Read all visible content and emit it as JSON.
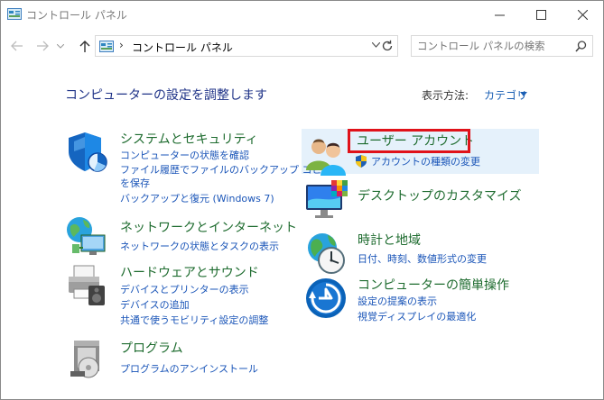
{
  "window": {
    "title": "コントロール パネル"
  },
  "address": {
    "separator": "›",
    "path": "コントロール パネル"
  },
  "search": {
    "placeholder": "コントロール パネルの検索"
  },
  "main": {
    "heading": "コンピューターの設定を調整します",
    "view_by_label": "表示方法:",
    "view_by_value": "カテゴリ"
  },
  "categories": {
    "system_security": {
      "title": "システムとセキュリティ",
      "links": [
        "コンピューターの状態を確認",
        "ファイル履歴でファイルのバックアップ コピー",
        "を保存",
        "バックアップと復元 (Windows 7)"
      ]
    },
    "network": {
      "title": "ネットワークとインターネット",
      "links": [
        "ネットワークの状態とタスクの表示"
      ]
    },
    "hardware_sound": {
      "title": "ハードウェアとサウンド",
      "links": [
        "デバイスとプリンターの表示",
        "デバイスの追加",
        "共通で使うモビリティ設定の調整"
      ]
    },
    "programs": {
      "title": "プログラム",
      "links": [
        "プログラムのアンインストール"
      ]
    },
    "user_accounts": {
      "title": "ユーザー アカウント",
      "links": [
        "アカウントの種類の変更"
      ]
    },
    "appearance": {
      "title": "デスクトップのカスタマイズ",
      "links": []
    },
    "clock_region": {
      "title": "時計と地域",
      "links": [
        "日付、時刻、数値形式の変更"
      ]
    },
    "ease_of_access": {
      "title": "コンピューターの簡単操作",
      "links": [
        "設定の提案の表示",
        "視覚ディスプレイの最適化"
      ]
    }
  },
  "colors": {
    "title_green": "#1d6b2e",
    "link_blue": "#1a55b8",
    "highlight_red": "#e0121a"
  }
}
